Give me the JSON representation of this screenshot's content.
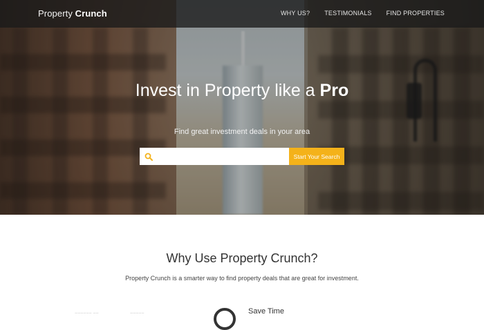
{
  "brand": {
    "prefix": "Property",
    "suffix": "Crunch"
  },
  "nav": {
    "items": [
      {
        "label": "WHY US?"
      },
      {
        "label": "TESTIMONIALS"
      },
      {
        "label": "FIND PROPERTIES"
      }
    ]
  },
  "hero": {
    "title_prefix": "Invest in Property like a",
    "title_emphasis": "Pro",
    "subtitle": "Find great investment deals in your area",
    "search": {
      "value": "",
      "placeholder": "",
      "button_label": "Start Your Search"
    }
  },
  "why": {
    "title": "Why Use Property Crunch?",
    "description": "Property Crunch is a smarter way to find property deals that are great for investment.",
    "features": [
      {
        "title": "Save Time"
      }
    ]
  },
  "colors": {
    "accent": "#f4b21a",
    "nav_bg": "#191919"
  }
}
